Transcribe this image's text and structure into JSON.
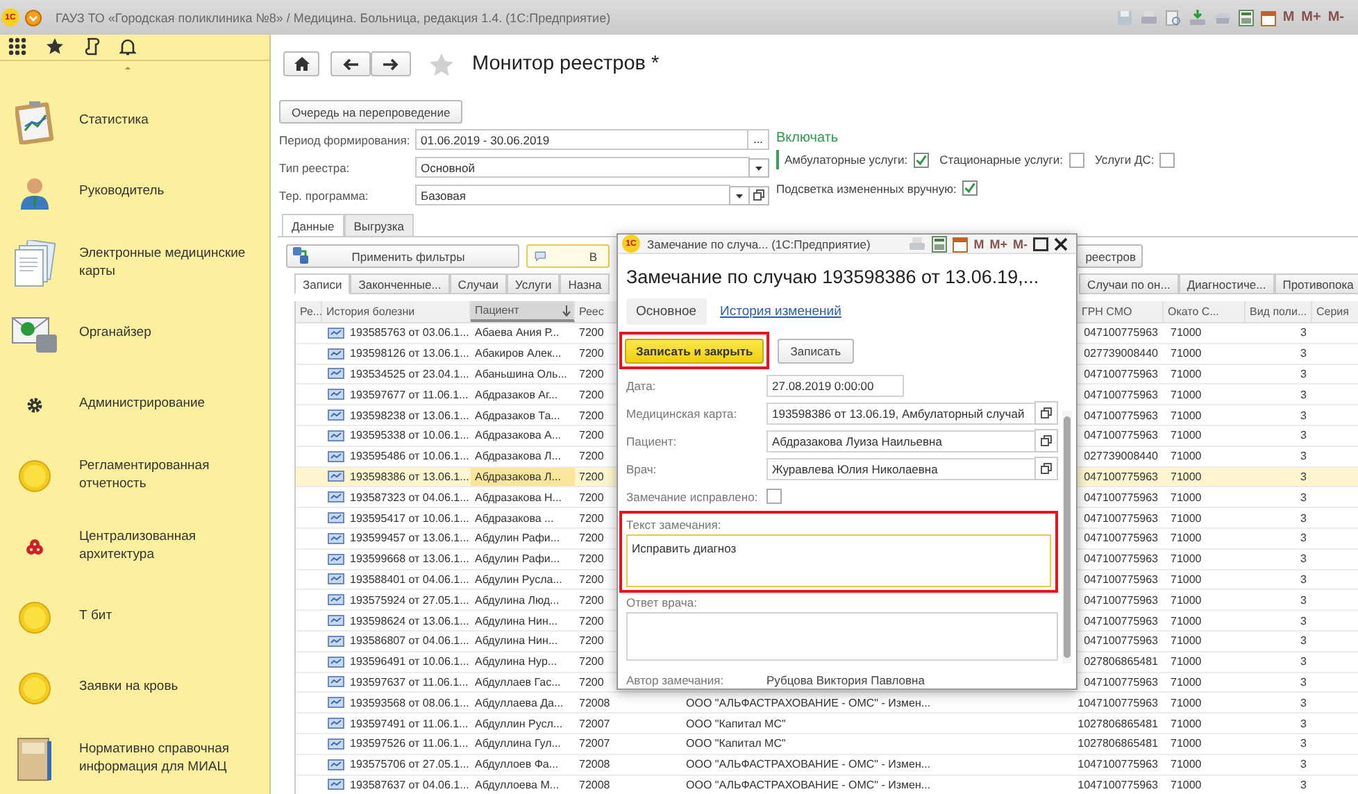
{
  "title_bar": {
    "logo": "1С",
    "text": "ГАУЗ ТО «Городская поликлиника №8» / Медицина. Больница, редакция 1.4. (1С:Предприятие)",
    "memory_buttons": [
      "M",
      "M+",
      "M-"
    ]
  },
  "sidebar": {
    "items": [
      {
        "label": "Статистика"
      },
      {
        "label": "Руководитель"
      },
      {
        "label": "Электронные медицинские карты"
      },
      {
        "label": "Органайзер"
      },
      {
        "label": "Администрирование"
      },
      {
        "label": "Регламентированная отчетность"
      },
      {
        "label": "Централизованная архитектура"
      },
      {
        "label": "Т бит"
      },
      {
        "label": "Заявки на кровь"
      },
      {
        "label": "Нормативно справочная информация для МИАЦ"
      }
    ]
  },
  "page": {
    "title": "Монитор реестров *",
    "requeue_button": "Очередь на перепроведение",
    "fields": [
      {
        "label": "Период формирования:",
        "value": "01.06.2019 - 30.06.2019",
        "kind": "period",
        "choose_button": "..."
      },
      {
        "label": "Тип реестра:",
        "value": "Основной",
        "kind": "select"
      },
      {
        "label": "Тер. программа:",
        "value": "Базовая",
        "kind": "select-open"
      }
    ],
    "include": {
      "title": "Включать",
      "options": [
        {
          "label": "Амбулаторные услуги:",
          "checked": true
        },
        {
          "label": "Стационарные услуги:",
          "checked": false
        },
        {
          "label": "Услуги ДС:",
          "checked": false
        }
      ],
      "highlight_changes": {
        "label": "Подсветка измененных вручную:",
        "checked": true
      }
    },
    "tabs": [
      {
        "label": "Данные",
        "selected": true
      },
      {
        "label": "Выгрузка",
        "selected": false
      }
    ],
    "toolbar": {
      "apply_button": "Применить фильтры",
      "comment_button": "В",
      "registries_button": "реестров"
    },
    "table_tabs_left": [
      {
        "label": "Записи",
        "selected": true
      },
      {
        "label": "Законченные...",
        "selected": false
      },
      {
        "label": "Случаи",
        "selected": false
      },
      {
        "label": "Услуги",
        "selected": false
      },
      {
        "label": "Назна",
        "selected": false
      }
    ],
    "table_tabs_right": [
      {
        "label": "Случаи по он...",
        "selected": false
      },
      {
        "label": "Диагностиче...",
        "selected": false
      },
      {
        "label": "Противопока",
        "selected": false
      }
    ],
    "table": {
      "columns_left": [
        {
          "label": "Ре...",
          "sorted": false
        },
        {
          "label": "История болезни",
          "sorted": false
        },
        {
          "label": "Пациент",
          "sorted": true
        },
        {
          "label": "Реес",
          "sorted": false
        }
      ],
      "columns_right": [
        {
          "label": "ГРН СМО",
          "sorted": false
        },
        {
          "label": "Окато С...",
          "sorted": false
        },
        {
          "label": "Вид поли...",
          "sorted": false
        },
        {
          "label": "Серия",
          "sorted": false
        }
      ],
      "rows": [
        {
          "history": "193585763 от 03.06.1...",
          "patient": "Абаева Ания Р...",
          "registry": "7200",
          "ogrn": "047100775963",
          "okato": "71000",
          "policy_type": "3",
          "selected": false
        },
        {
          "history": "193598126 от 13.06.1...",
          "patient": "Абакиров Алек...",
          "registry": "7200",
          "ogrn": "027739008440",
          "okato": "71000",
          "policy_type": "3",
          "selected": false
        },
        {
          "history": "193534525 от 23.04.1...",
          "patient": "Абаньшина Оль...",
          "registry": "7200",
          "ogrn": "047100775963",
          "okato": "71000",
          "policy_type": "3",
          "selected": false
        },
        {
          "history": "193597677 от 11.06.1...",
          "patient": "Абдразаков Аг...",
          "registry": "7200",
          "ogrn": "047100775963",
          "okato": "71000",
          "policy_type": "3",
          "selected": false
        },
        {
          "history": "193598238 от 13.06.1...",
          "patient": "Абдразаков Та...",
          "registry": "7200",
          "ogrn": "047100775963",
          "okato": "71000",
          "policy_type": "3",
          "selected": false
        },
        {
          "history": "193595338 от 10.06.1...",
          "patient": "Абдразакова А...",
          "registry": "7200",
          "ogrn": "047100775963",
          "okato": "71000",
          "policy_type": "3",
          "selected": false
        },
        {
          "history": "193595486 от 10.06.1...",
          "patient": "Абдразакова Л...",
          "registry": "7200",
          "ogrn": "027739008440",
          "okato": "71000",
          "policy_type": "3",
          "selected": false
        },
        {
          "history": "193598386 от 13.06.1...",
          "patient": "Абдразакова Л...",
          "registry": "7200",
          "ogrn": "047100775963",
          "okato": "71000",
          "policy_type": "3",
          "selected": true
        },
        {
          "history": "193587323 от 04.06.1...",
          "patient": "Абдразакова Н...",
          "registry": "7200",
          "ogrn": "047100775963",
          "okato": "71000",
          "policy_type": "3",
          "selected": false
        },
        {
          "history": "193595417 от 10.06.1...",
          "patient": "Абдразакова ...",
          "registry": "7200",
          "ogrn": "047100775963",
          "okato": "71000",
          "policy_type": "3",
          "selected": false
        },
        {
          "history": "193599457 от 13.06.1...",
          "patient": "Абдулин Рафи...",
          "registry": "7200",
          "ogrn": "047100775963",
          "okato": "71000",
          "policy_type": "3",
          "selected": false
        },
        {
          "history": "193599668 от 13.06.1...",
          "patient": "Абдулин Рафи...",
          "registry": "7200",
          "ogrn": "047100775963",
          "okato": "71000",
          "policy_type": "3",
          "selected": false
        },
        {
          "history": "193588401 от 04.06.1...",
          "patient": "Абдулин Русла...",
          "registry": "7200",
          "ogrn": "047100775963",
          "okato": "71000",
          "policy_type": "3",
          "selected": false
        },
        {
          "history": "193575924 от 27.05.1...",
          "patient": "Абдулина Люд...",
          "registry": "7200",
          "ogrn": "047100775963",
          "okato": "71000",
          "policy_type": "3",
          "selected": false
        },
        {
          "history": "193598624 от 13.06.1...",
          "patient": "Абдулина Нин...",
          "registry": "7200",
          "ogrn": "047100775963",
          "okato": "71000",
          "policy_type": "3",
          "selected": false
        },
        {
          "history": "193586807 от 04.06.1...",
          "patient": "Абдулина Нин...",
          "registry": "7200",
          "ogrn": "047100775963",
          "okato": "71000",
          "policy_type": "3",
          "selected": false
        },
        {
          "history": "193596491 от 10.06.1...",
          "patient": "Абдулина Нур...",
          "registry": "7200",
          "ogrn": "027806865481",
          "okato": "71000",
          "policy_type": "3",
          "selected": false
        },
        {
          "history": "193597637 от 11.06.1...",
          "patient": "Абдуллаев Гас...",
          "registry": "7200",
          "ogrn": "047100775963",
          "okato": "71000",
          "policy_type": "3",
          "selected": false
        },
        {
          "history": "193593568 от 08.06.1...",
          "patient": "Абдуллаева Да...",
          "registry": "72008",
          "insurer": "ООО \"АЛЬФАСТРАХОВАНИЕ - ОМС\" - Измен...",
          "ogrn": "1047100775963",
          "okato": "71000",
          "policy_type": "3",
          "selected": false
        },
        {
          "history": "193597491 от 11.06.1...",
          "patient": "Абдуллин Русл...",
          "registry": "72007",
          "insurer": "ООО \"Капитал МС\"",
          "ogrn": "1027806865481",
          "okato": "71000",
          "policy_type": "3",
          "selected": false
        },
        {
          "history": "193597526 от 11.06.1...",
          "patient": "Абдуллина Гул...",
          "registry": "72007",
          "insurer": "ООО \"Капитал МС\"",
          "ogrn": "1027806865481",
          "okato": "71000",
          "policy_type": "3",
          "selected": false
        },
        {
          "history": "193575706 от 27.05.1...",
          "patient": "Абдуллоев Фа...",
          "registry": "72008",
          "insurer": "ООО \"АЛЬФАСТРАХОВАНИЕ - ОМС\" - Измен...",
          "ogrn": "1047100775963",
          "okato": "71000",
          "policy_type": "3",
          "selected": false
        },
        {
          "history": "193587637 от 04.06.1...",
          "patient": "Абдуллоева М...",
          "registry": "72008",
          "insurer": "ООО \"АЛЬФАСТРАХОВАНИЕ - ОМС\" - Измен...",
          "ogrn": "1047100775963",
          "okato": "71000",
          "policy_type": "3",
          "selected": false
        }
      ]
    }
  },
  "dialog": {
    "logo": "1С",
    "window_title": "Замечание  по случа... (1С:Предприятие)",
    "memory_buttons": [
      "M",
      "M+",
      "M-"
    ],
    "heading": "Замечание  по случаю 193598386 от 13.06.19,...",
    "tabs": [
      {
        "label": "Основное",
        "selected": true
      },
      {
        "label": "История изменений",
        "selected": false
      }
    ],
    "buttons": [
      {
        "label": "Записать и закрыть",
        "kind": "primary",
        "highlighted": true
      },
      {
        "label": "Записать",
        "kind": "default",
        "highlighted": false
      }
    ],
    "fields": [
      {
        "label": "Дата:",
        "value": "27.08.2019  0:00:00",
        "kind": "date"
      },
      {
        "label": "Медицинская карта:",
        "value": "193598386 от 13.06.19, Амбулаторный случай",
        "kind": "link"
      },
      {
        "label": "Пациент:",
        "value": "Абдразакова Луиза Наильевна",
        "kind": "link"
      },
      {
        "label": "Врач:",
        "value": "Журавлева Юлия Николаевна",
        "kind": "link"
      }
    ],
    "fixed": {
      "label": "Замечание исправлено:",
      "checked": false
    },
    "comment": {
      "label": "Текст замечания:",
      "value": "Исправить диагноз",
      "highlighted": true
    },
    "answer": {
      "label": "Ответ врача:"
    },
    "author": {
      "label": "Автор замечания:",
      "value": "Рубцова Виктория Павловна"
    }
  }
}
